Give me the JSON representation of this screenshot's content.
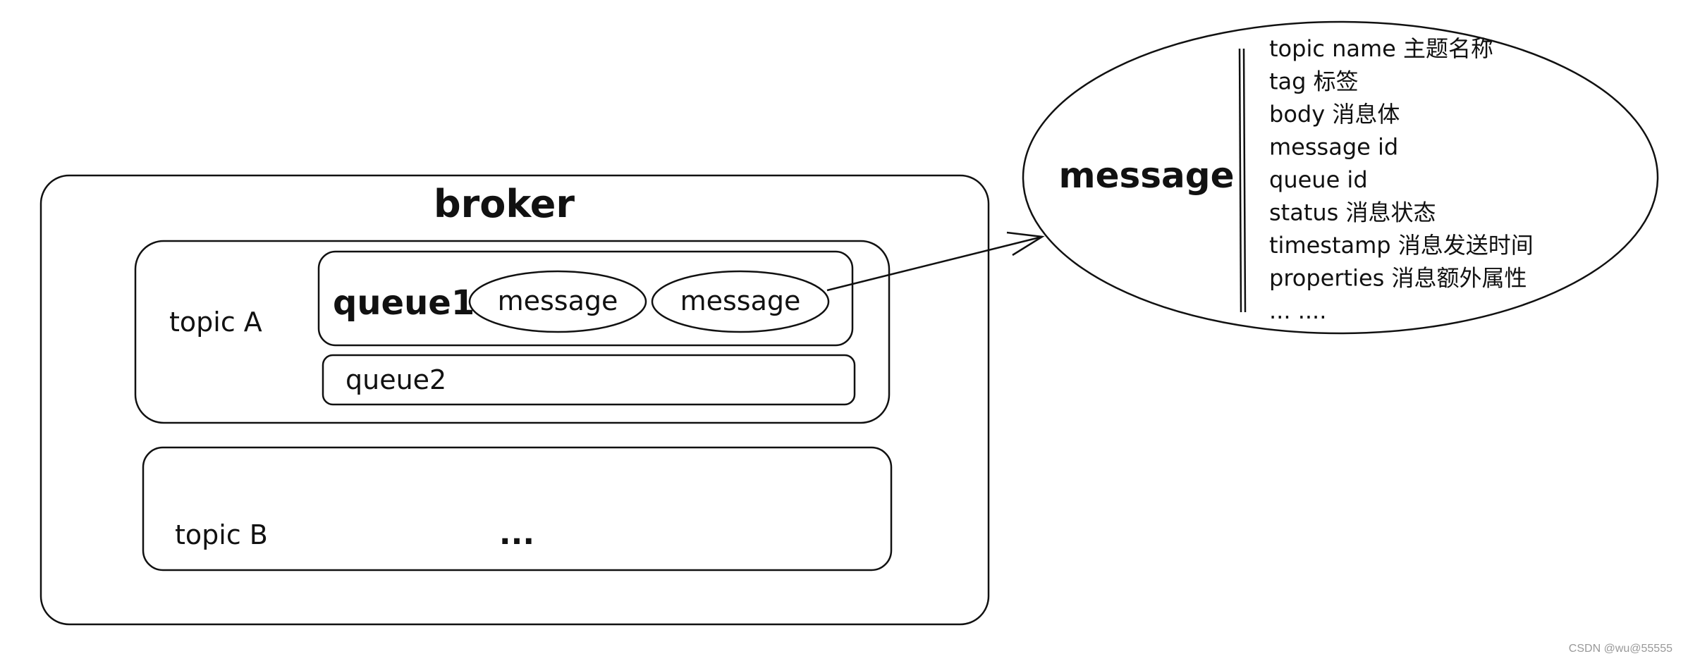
{
  "broker": {
    "label": "broker"
  },
  "topicA": {
    "label": "topic A"
  },
  "queue1": {
    "label": "queue1",
    "messages": [
      "message",
      "message"
    ]
  },
  "queue2": {
    "label": "queue2"
  },
  "topicB": {
    "label": "topic B",
    "ellipsis": "..."
  },
  "message_detail": {
    "label": "message",
    "fields": [
      "topic name 主题名称",
      "tag 标签",
      "body 消息体",
      "message id",
      "queue id",
      "status 消息状态",
      "timestamp 消息发送时间",
      "properties 消息额外属性",
      "... ...."
    ]
  },
  "watermark": "CSDN @wu@55555",
  "colors": {
    "stroke": "#111111",
    "background": "#ffffff"
  }
}
